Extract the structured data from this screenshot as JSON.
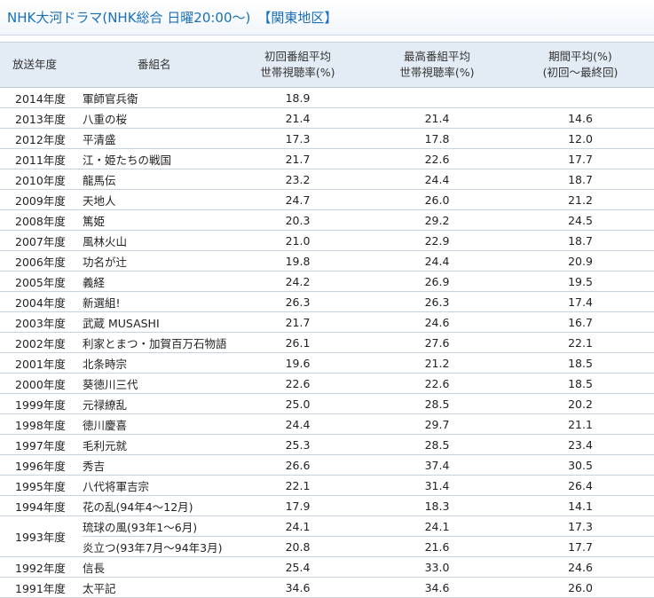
{
  "page": {
    "title": "NHK大河ドラマ(NHK総合 日曜20:00～)",
    "region": "【関東地区】"
  },
  "table": {
    "headers": {
      "year": "放送年度",
      "program": "番組名",
      "first_line1": "初回番組平均",
      "first_line2": "世帯視聴率(%)",
      "max_line1": "最高番組平均",
      "max_line2": "世帯視聴率(%)",
      "avg_line1": "期間平均(%)",
      "avg_line2": "(初回～最終回)"
    },
    "rows": [
      {
        "year": "2014年度",
        "program": "軍師官兵衛",
        "first": "18.9",
        "max": "",
        "avg": ""
      },
      {
        "year": "2013年度",
        "program": "八重の桜",
        "first": "21.4",
        "max": "21.4",
        "avg": "14.6"
      },
      {
        "year": "2012年度",
        "program": "平清盛",
        "first": "17.3",
        "max": "17.8",
        "avg": "12.0"
      },
      {
        "year": "2011年度",
        "program": "江・姫たちの戦国",
        "first": "21.7",
        "max": "22.6",
        "avg": "17.7"
      },
      {
        "year": "2010年度",
        "program": "龍馬伝",
        "first": "23.2",
        "max": "24.4",
        "avg": "18.7"
      },
      {
        "year": "2009年度",
        "program": "天地人",
        "first": "24.7",
        "max": "26.0",
        "avg": "21.2"
      },
      {
        "year": "2008年度",
        "program": "篤姫",
        "first": "20.3",
        "max": "29.2",
        "avg": "24.5"
      },
      {
        "year": "2007年度",
        "program": "風林火山",
        "first": "21.0",
        "max": "22.9",
        "avg": "18.7"
      },
      {
        "year": "2006年度",
        "program": "功名が辻",
        "first": "19.8",
        "max": "24.4",
        "avg": "20.9"
      },
      {
        "year": "2005年度",
        "program": "義経",
        "first": "24.2",
        "max": "26.9",
        "avg": "19.5"
      },
      {
        "year": "2004年度",
        "program": "新選組!",
        "first": "26.3",
        "max": "26.3",
        "avg": "17.4"
      },
      {
        "year": "2003年度",
        "program": "武蔵 MUSASHI",
        "first": "21.7",
        "max": "24.6",
        "avg": "16.7"
      },
      {
        "year": "2002年度",
        "program": "利家とまつ・加賀百万石物語",
        "first": "26.1",
        "max": "27.6",
        "avg": "22.1"
      },
      {
        "year": "2001年度",
        "program": "北条時宗",
        "first": "19.6",
        "max": "21.2",
        "avg": "18.5"
      },
      {
        "year": "2000年度",
        "program": "葵徳川三代",
        "first": "22.6",
        "max": "22.6",
        "avg": "18.5"
      },
      {
        "year": "1999年度",
        "program": "元禄繚乱",
        "first": "25.0",
        "max": "28.5",
        "avg": "20.2"
      },
      {
        "year": "1998年度",
        "program": "徳川慶喜",
        "first": "24.4",
        "max": "29.7",
        "avg": "21.1"
      },
      {
        "year": "1997年度",
        "program": "毛利元就",
        "first": "25.3",
        "max": "28.5",
        "avg": "23.4"
      },
      {
        "year": "1996年度",
        "program": "秀吉",
        "first": "26.6",
        "max": "37.4",
        "avg": "30.5"
      },
      {
        "year": "1995年度",
        "program": "八代将軍吉宗",
        "first": "22.1",
        "max": "31.4",
        "avg": "26.4"
      },
      {
        "year": "1994年度",
        "program": "花の乱(94年4～12月)",
        "first": "17.9",
        "max": "18.3",
        "avg": "14.1"
      },
      {
        "year": "1993年度",
        "program": "琉球の風(93年1～6月)",
        "first": "24.1",
        "max": "24.1",
        "avg": "17.3"
      },
      {
        "year": "",
        "program": "炎立つ(93年7月～94年3月)",
        "first": "20.8",
        "max": "21.6",
        "avg": "17.7"
      },
      {
        "year": "1992年度",
        "program": "信長",
        "first": "25.4",
        "max": "33.0",
        "avg": "24.6"
      },
      {
        "year": "1991年度",
        "program": "太平記",
        "first": "34.6",
        "max": "34.6",
        "avg": "26.0"
      }
    ]
  }
}
